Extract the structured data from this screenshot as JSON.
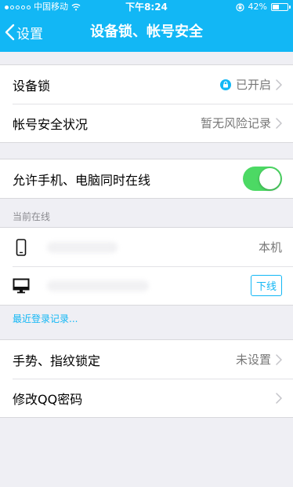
{
  "status_bar": {
    "carrier": "中国移动",
    "time": "下午8:24",
    "battery_percent": "42%",
    "battery_level": 0.42,
    "icons": [
      "signal-icon",
      "wifi-icon",
      "orientation-lock-icon",
      "battery-icon"
    ]
  },
  "nav": {
    "back_label": "设置",
    "title": "设备锁、帐号安全"
  },
  "security": {
    "device_lock": {
      "label": "设备锁",
      "value": "已开启",
      "icon": "lock-icon"
    },
    "account_status": {
      "label": "帐号安全状况",
      "value": "暂无风险记录"
    }
  },
  "online": {
    "allow_label": "允许手机、电脑同时在线",
    "toggle_on": true
  },
  "current_online": {
    "header": "当前在线",
    "devices": [
      {
        "icon": "phone-icon",
        "tag": "本机"
      },
      {
        "icon": "monitor-icon",
        "action": "下线"
      }
    ]
  },
  "recent_link": "最近登录记录...",
  "lock_settings": {
    "gesture": {
      "label": "手势、指纹锁定",
      "value": "未设置"
    },
    "change_password": {
      "label": "修改QQ密码"
    }
  },
  "colors": {
    "brand": "#12b7f5",
    "toggle_on": "#4cd964",
    "background": "#efeff4"
  }
}
